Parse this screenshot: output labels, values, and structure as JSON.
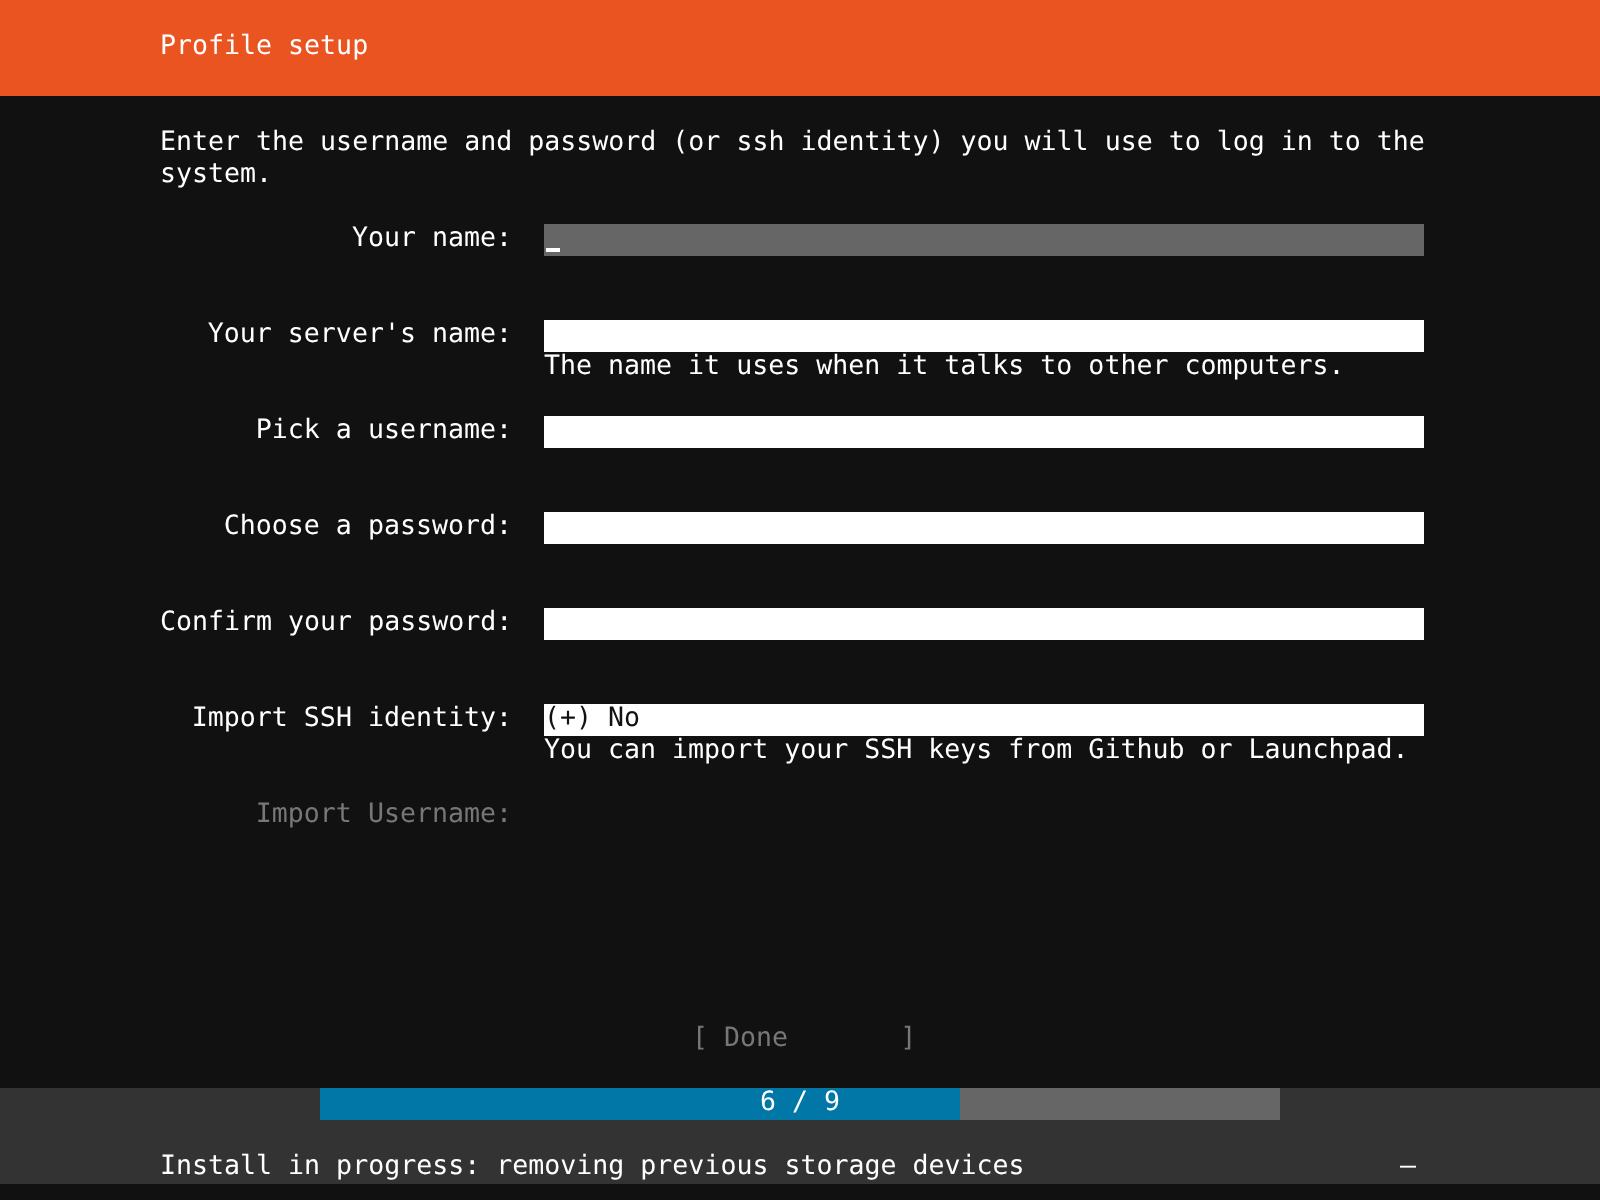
{
  "header": {
    "title": "Profile setup"
  },
  "intro": "Enter the username and password (or ssh identity) you will use to log in to the system.",
  "fields": [
    {
      "label": "Your name:",
      "kind": "text",
      "focused": true,
      "disabled": false
    },
    {
      "label": "Your server's name:",
      "kind": "text",
      "focused": false,
      "disabled": false,
      "hint": "The name it uses when it talks to other computers."
    },
    {
      "label": "Pick a username:",
      "kind": "text",
      "focused": false,
      "disabled": false
    },
    {
      "label": "Choose a password:",
      "kind": "text",
      "focused": false,
      "disabled": false
    },
    {
      "label": "Confirm your password:",
      "kind": "text",
      "focused": false,
      "disabled": false
    },
    {
      "label": "Import SSH identity:",
      "kind": "select",
      "value": "(+) No",
      "focused": false,
      "disabled": false,
      "hint": "You can import your SSH keys from Github or Launchpad."
    },
    {
      "label": "Import Username:",
      "disabled": true
    }
  ],
  "done_button": {
    "label": "[ Done       ]",
    "disabled": true
  },
  "progress": {
    "label": "6 / 9",
    "level": 0.6667
  },
  "status_bar": {
    "text": "Install in progress: removing previous storage devices",
    "spinner": "–"
  }
}
